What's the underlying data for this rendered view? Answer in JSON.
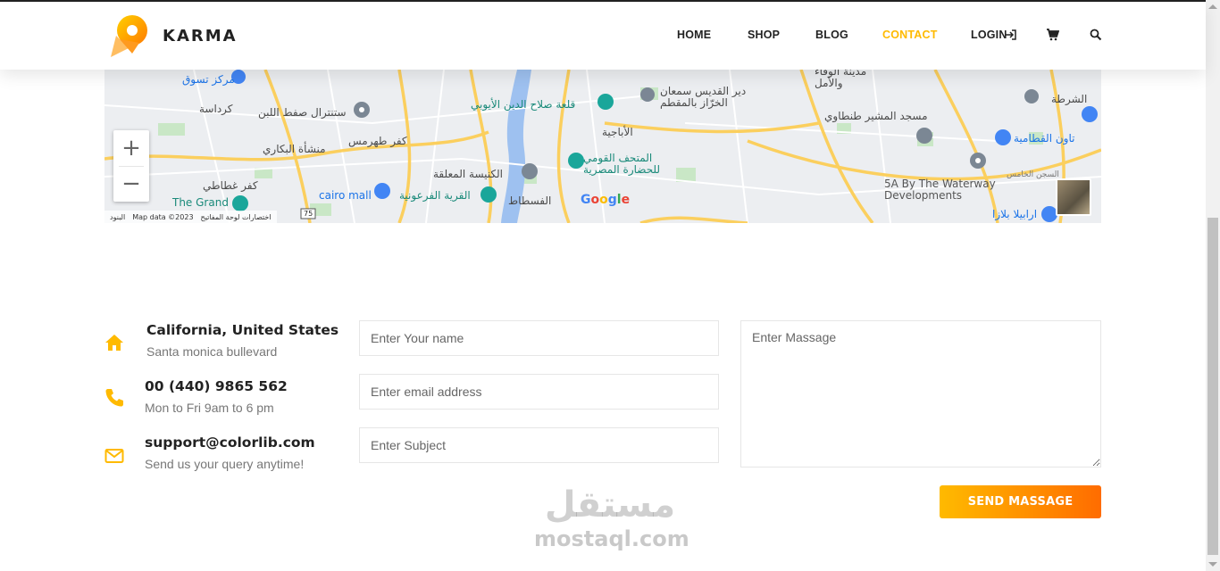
{
  "brand": {
    "name": "KARMA",
    "accent": "#ffba00",
    "accent_end": "#ff6c00"
  },
  "nav": {
    "items": [
      {
        "label": "HOME",
        "active": false
      },
      {
        "label": "SHOP",
        "active": false
      },
      {
        "label": "BLOG",
        "active": false
      },
      {
        "label": "CONTACT",
        "active": true
      },
      {
        "label": "LOGIN",
        "active": false
      }
    ],
    "icons": [
      "login-arrow-icon",
      "cart-icon",
      "search-icon"
    ]
  },
  "map": {
    "labels": [
      "مركز تسوق",
      "كرداسة",
      "ستنترال صفط اللبن",
      "كفر طهرمس",
      "منشأة البكاري",
      "كفر غطاطي",
      "The Grand",
      "cairo mall",
      "القرية الفرعونية",
      "الكنيسة المعلقة",
      "قلعة صلاح الدين الأيوبي",
      "الأباجية",
      "المتحف القومي للحضارة المصرية",
      "الفسطاط",
      "دير القديس سمعان الخرّاز بالمقطم",
      "مدينة الوفاء والأمل",
      "مسجد المشير طنطاوي",
      "5A By The Waterway Developments",
      "تاون القطامية",
      "ارابيلا بلازا",
      "السجن الخامس",
      "الشرطة"
    ],
    "zoom_in": "+",
    "zoom_out": "−",
    "google": "Google",
    "attribution": {
      "map_data": "Map data ©2023",
      "shortcuts": "اختصارات لوحة المفاتيح",
      "terms": "البنود"
    },
    "road_number": "75"
  },
  "contact": {
    "items": [
      {
        "icon": "home-icon",
        "title": "California, United States",
        "sub": "Santa monica bullevard"
      },
      {
        "icon": "phone-icon",
        "title": "00 (440) 9865 562",
        "sub": "Mon to Fri 9am to 6 pm"
      },
      {
        "icon": "mail-icon",
        "title": "support@colorlib.com",
        "sub": "Send us your query anytime!"
      }
    ],
    "form": {
      "name_placeholder": "Enter Your name",
      "email_placeholder": "Enter email address",
      "subject_placeholder": "Enter Subject",
      "message_placeholder": "Enter Massage",
      "submit_label": "SEND MASSAGE"
    }
  },
  "watermark": {
    "arabic": "مستقل",
    "latin": "mostaql.com"
  }
}
